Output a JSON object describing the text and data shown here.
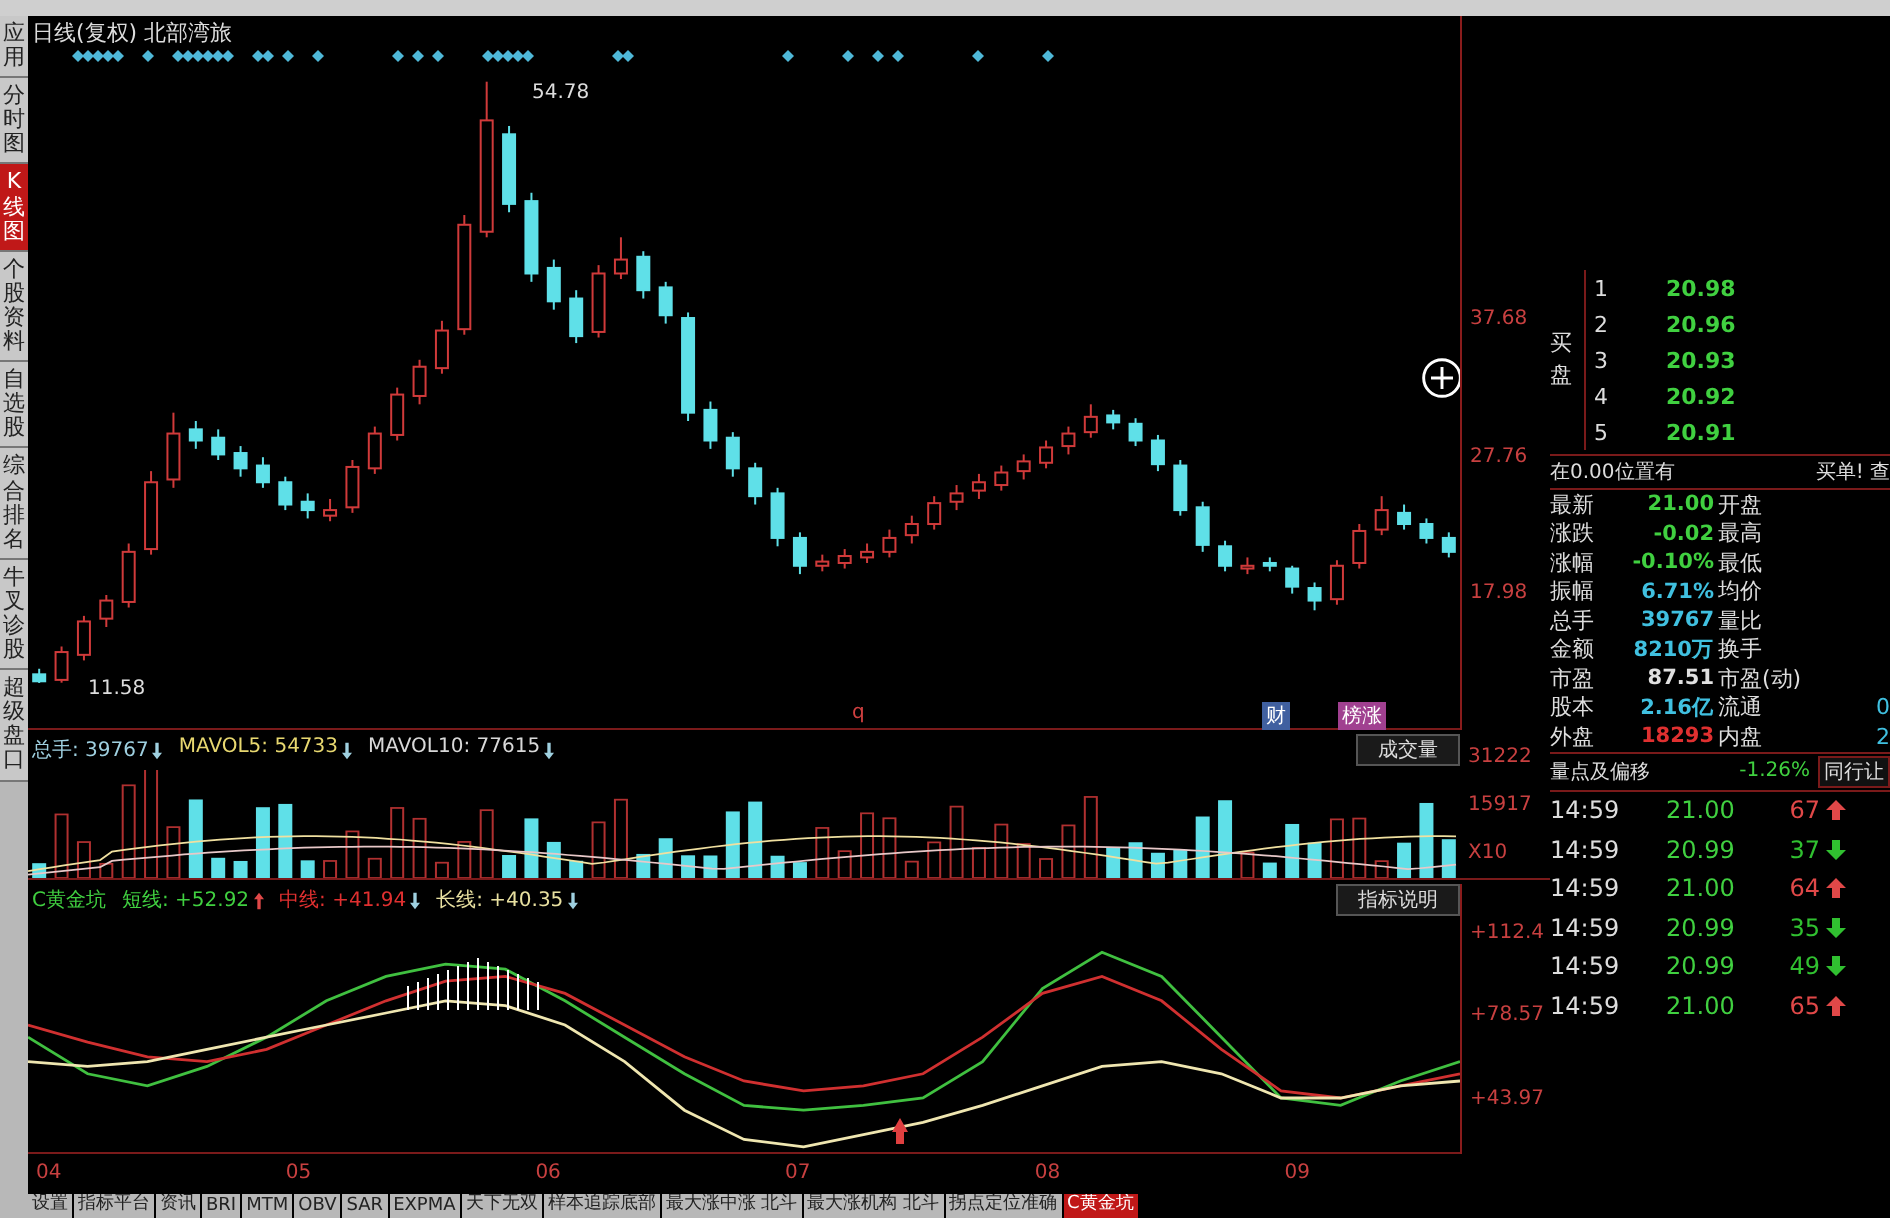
{
  "sidebar": {
    "items": [
      {
        "label": "应用",
        "selected": false
      },
      {
        "label": "分时图",
        "selected": false
      },
      {
        "label": "K线图",
        "selected": true
      },
      {
        "label": "个股资料",
        "selected": false
      },
      {
        "label": "自选股",
        "selected": false
      },
      {
        "label": "综合排名",
        "selected": false
      },
      {
        "label": "牛叉诊股",
        "selected": false
      },
      {
        "label": "超级盘口",
        "selected": false
      }
    ]
  },
  "price_chart": {
    "title": "日线(复权) 北部湾旅",
    "high_label": "54.78",
    "low_label": "11.58",
    "markers": [
      "q",
      "财",
      "榜涨"
    ],
    "chart_data": {
      "type": "candlestick",
      "categories": [
        null,
        null,
        null,
        null,
        null,
        null,
        null,
        null,
        null,
        null,
        null,
        null,
        null,
        null,
        null,
        null,
        null,
        null,
        null,
        null,
        null,
        null,
        null,
        null,
        null,
        null,
        null,
        null,
        null,
        null,
        null,
        null,
        null,
        null,
        null,
        null,
        null,
        null,
        null,
        null,
        null,
        null,
        null,
        null,
        null,
        null,
        null,
        null,
        null,
        null,
        null,
        null,
        null,
        null,
        null,
        null,
        null,
        null,
        null,
        null,
        null,
        null,
        null,
        null
      ],
      "ylim": [
        8.2,
        59.5
      ],
      "yticks": [
        {
          "value": 37.68,
          "label": "37.68"
        },
        {
          "value": 27.76,
          "label": "27.76"
        },
        {
          "value": 17.98,
          "label": "17.98"
        }
      ],
      "ohlc": [
        [
          12.2,
          12.6,
          11.58,
          11.7
        ],
        [
          11.8,
          14.2,
          11.6,
          13.8
        ],
        [
          13.6,
          16.4,
          13.2,
          16.0
        ],
        [
          16.2,
          17.9,
          15.6,
          17.5
        ],
        [
          17.4,
          21.6,
          17.0,
          21.0
        ],
        [
          21.2,
          26.8,
          20.8,
          26.0
        ],
        [
          26.2,
          31.0,
          25.6,
          29.5
        ],
        [
          29.8,
          30.4,
          28.4,
          29.0
        ],
        [
          29.2,
          29.8,
          27.6,
          28.0
        ],
        [
          28.1,
          28.6,
          26.4,
          27.0
        ],
        [
          27.2,
          27.8,
          25.6,
          26.0
        ],
        [
          26.0,
          26.4,
          24.0,
          24.4
        ],
        [
          24.6,
          25.2,
          23.4,
          24.0
        ],
        [
          23.6,
          24.8,
          23.2,
          24.0
        ],
        [
          24.2,
          27.6,
          23.8,
          27.1
        ],
        [
          27.0,
          30.0,
          26.6,
          29.5
        ],
        [
          29.4,
          32.8,
          29.0,
          32.3
        ],
        [
          32.2,
          34.8,
          31.6,
          34.3
        ],
        [
          34.2,
          37.6,
          33.8,
          36.9
        ],
        [
          37.0,
          45.2,
          36.6,
          44.5
        ],
        [
          44.0,
          54.78,
          43.6,
          52.0
        ],
        [
          51.0,
          51.6,
          45.4,
          46.0
        ],
        [
          46.2,
          46.8,
          40.4,
          41.0
        ],
        [
          41.4,
          42.0,
          38.4,
          39.0
        ],
        [
          39.2,
          39.8,
          36.0,
          36.5
        ],
        [
          36.8,
          41.6,
          36.4,
          41.0
        ],
        [
          41.0,
          43.6,
          40.6,
          42.0
        ],
        [
          42.2,
          42.6,
          39.2,
          39.8
        ],
        [
          40.0,
          40.4,
          37.4,
          38.0
        ],
        [
          37.8,
          38.2,
          30.4,
          31.0
        ],
        [
          31.2,
          31.8,
          28.4,
          29.0
        ],
        [
          29.2,
          29.6,
          26.4,
          27.0
        ],
        [
          27.0,
          27.4,
          24.4,
          25.0
        ],
        [
          25.2,
          25.6,
          21.4,
          22.0
        ],
        [
          22.0,
          22.4,
          19.4,
          20.0
        ],
        [
          20.0,
          20.8,
          19.6,
          20.3
        ],
        [
          20.2,
          21.2,
          19.8,
          20.7
        ],
        [
          20.6,
          21.6,
          20.2,
          21.0
        ],
        [
          21.0,
          22.6,
          20.6,
          22.0
        ],
        [
          22.2,
          23.6,
          21.6,
          23.0
        ],
        [
          23.0,
          25.0,
          22.6,
          24.5
        ],
        [
          24.6,
          25.8,
          24.0,
          25.2
        ],
        [
          25.4,
          26.6,
          24.8,
          26.0
        ],
        [
          25.8,
          27.2,
          25.4,
          26.7
        ],
        [
          26.8,
          28.0,
          26.2,
          27.5
        ],
        [
          27.4,
          29.0,
          27.0,
          28.5
        ],
        [
          28.6,
          30.0,
          28.0,
          29.5
        ],
        [
          29.6,
          31.6,
          29.2,
          30.7
        ],
        [
          30.8,
          31.2,
          29.8,
          30.3
        ],
        [
          30.2,
          30.6,
          28.6,
          29.0
        ],
        [
          29.0,
          29.4,
          26.8,
          27.3
        ],
        [
          27.2,
          27.6,
          23.6,
          24.0
        ],
        [
          24.2,
          24.6,
          21.0,
          21.5
        ],
        [
          21.4,
          21.8,
          19.6,
          20.0
        ],
        [
          19.8,
          20.6,
          19.4,
          20.0
        ],
        [
          20.2,
          20.6,
          19.6,
          20.0
        ],
        [
          19.8,
          20.0,
          18.0,
          18.5
        ],
        [
          18.4,
          18.8,
          16.8,
          17.5
        ],
        [
          17.6,
          20.4,
          17.2,
          20.0
        ],
        [
          20.2,
          23.0,
          19.8,
          22.5
        ],
        [
          22.6,
          25.0,
          22.2,
          24.0
        ],
        [
          23.8,
          24.4,
          22.6,
          23.0
        ],
        [
          23.0,
          23.4,
          21.6,
          22.0
        ],
        [
          22.0,
          22.4,
          20.6,
          21.0
        ]
      ]
    }
  },
  "volume_chart": {
    "legend": [
      {
        "label": "总手: 39767",
        "color": "#9fd0e0"
      },
      {
        "label": "MAVOL5: 54733",
        "color": "#e8d870"
      },
      {
        "label": "MAVOL10: 77615",
        "color": "#d8d8d8"
      }
    ],
    "button": "成交量",
    "axis_labels": [
      "31222",
      "15917",
      "X10"
    ]
  },
  "indicator_chart": {
    "legend": [
      {
        "label": "C黄金坑",
        "color": "#40d040"
      },
      {
        "label": "短线: +52.92",
        "color": "#40d040",
        "up": true
      },
      {
        "label": "中线: +41.94",
        "color": "#e03030",
        "up": false
      },
      {
        "label": "长线: +40.35",
        "color": "#e8e0a0",
        "up": false
      }
    ],
    "button": "指标说明",
    "chart_data": {
      "type": "line",
      "ylim": [
        22,
        133
      ],
      "yticks": [
        {
          "value": 112.4,
          "label": "+112.4"
        },
        {
          "value": 78.57,
          "label": "+78.57"
        },
        {
          "value": 43.97,
          "label": "+43.97"
        }
      ],
      "series": [
        {
          "color": "#40c040",
          "values": [
            70,
            55,
            50,
            58,
            70,
            85,
            95,
            100,
            98,
            85,
            70,
            55,
            42,
            40,
            42,
            45,
            60,
            90,
            105,
            95,
            70,
            45,
            42,
            52,
            60
          ]
        },
        {
          "color": "#d03030",
          "values": [
            75,
            68,
            62,
            60,
            65,
            75,
            85,
            93,
            95,
            88,
            75,
            62,
            52,
            48,
            50,
            55,
            70,
            88,
            95,
            85,
            65,
            48,
            45,
            50,
            55
          ]
        },
        {
          "color": "#efe6b0",
          "values": [
            60,
            58,
            60,
            65,
            70,
            75,
            80,
            85,
            83,
            75,
            60,
            40,
            28,
            25,
            30,
            35,
            42,
            50,
            58,
            60,
            55,
            45,
            45,
            50,
            52
          ]
        }
      ]
    }
  },
  "months": [
    "04",
    "05",
    "06",
    "07",
    "08",
    "09"
  ],
  "order_book": {
    "side_label": "买盘",
    "rows": [
      {
        "level": "1",
        "price": "20.98"
      },
      {
        "level": "2",
        "price": "20.96"
      },
      {
        "level": "3",
        "price": "20.93"
      },
      {
        "level": "4",
        "price": "20.92"
      },
      {
        "level": "5",
        "price": "20.91"
      }
    ],
    "notice": "在0.00位置有",
    "notice_right": "买单! 查"
  },
  "stats": [
    {
      "label": "最新",
      "value": "21.00",
      "color": "#40d040",
      "label2": "开盘"
    },
    {
      "label": "涨跌",
      "value": "-0.02",
      "color": "#40d040",
      "label2": "最高"
    },
    {
      "label": "涨幅",
      "value": "-0.10%",
      "color": "#40d040",
      "label2": "最低"
    },
    {
      "label": "振幅",
      "value": "6.71%",
      "color": "#40c0e0",
      "label2": "均价"
    },
    {
      "label": "总手",
      "value": "39767",
      "color": "#40c0e0",
      "label2": "量比"
    },
    {
      "label": "金额",
      "value": "8210万",
      "color": "#40c0e0",
      "label2": "换手"
    },
    {
      "label": "市盈",
      "value": "87.51",
      "color": "#e0e0e0",
      "label2": "市盈(动)"
    },
    {
      "label": "股本",
      "value": "2.16亿",
      "color": "#40c0e0",
      "label2": "流通",
      "value2": "0"
    },
    {
      "label": "外盘",
      "value": "18293",
      "color": "#e03030",
      "label2": "内盘",
      "value2": "2"
    }
  ],
  "ticks_header": {
    "label": "量点及偏移",
    "change": "-1.26%",
    "tab": "同行让"
  },
  "ticks": [
    {
      "time": "14:59",
      "price": "21.00",
      "volume": "67",
      "up": true
    },
    {
      "time": "14:59",
      "price": "20.99",
      "volume": "37",
      "up": false
    },
    {
      "time": "14:59",
      "price": "21.00",
      "volume": "64",
      "up": true
    },
    {
      "time": "14:59",
      "price": "20.99",
      "volume": "35",
      "up": false
    },
    {
      "time": "14:59",
      "price": "20.99",
      "volume": "49",
      "up": false
    },
    {
      "time": "14:59",
      "price": "21.00",
      "volume": "65",
      "up": true
    }
  ],
  "bottom_tabs": [
    {
      "label": "设置",
      "selected": false
    },
    {
      "label": "指标平台",
      "selected": false
    },
    {
      "label": "资讯",
      "selected": false
    },
    {
      "label": "BRI",
      "selected": false
    },
    {
      "label": "MTM",
      "selected": false
    },
    {
      "label": "OBV",
      "selected": false
    },
    {
      "label": "SAR",
      "selected": false
    },
    {
      "label": "EXPMA",
      "selected": false
    },
    {
      "label": "天下无双",
      "selected": false
    },
    {
      "label": "样本追踪底部",
      "selected": false
    },
    {
      "label": "最大涨中涨 北斗",
      "selected": false
    },
    {
      "label": "最大涨机构 北斗",
      "selected": false
    },
    {
      "label": "拐点定位准确",
      "selected": false
    },
    {
      "label": "C黄金坑",
      "selected": true
    }
  ]
}
